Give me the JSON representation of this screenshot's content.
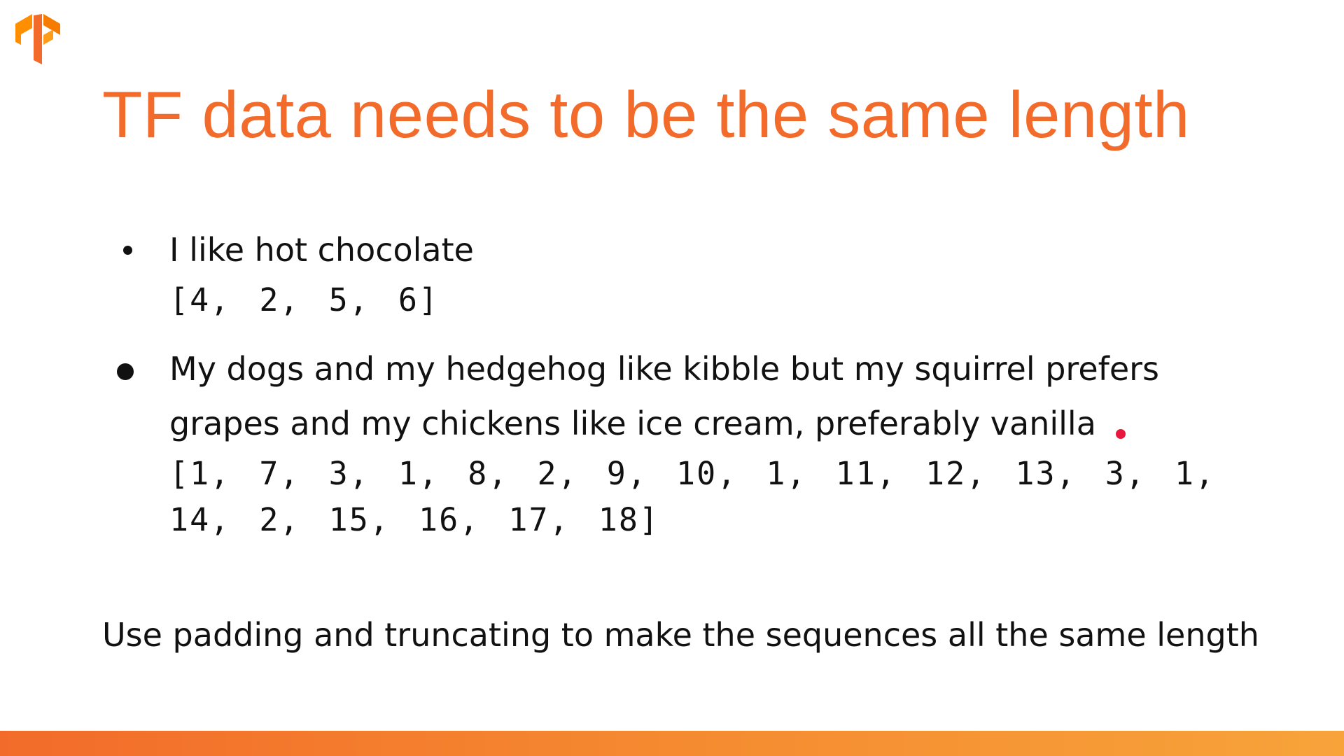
{
  "logo": {
    "icon": "tensorflow-logo-icon",
    "color": "#f26b2a"
  },
  "title": "TF data needs to be the same length",
  "bullets": [
    {
      "text": "I like hot chocolate",
      "sequence": "[4, 2, 5, 6]"
    },
    {
      "text": "My dogs and my hedgehog like kibble but my squirrel prefers grapes and my chickens like ice cream, preferably vanilla",
      "sequence": "[1, 7, 3, 1, 8, 2, 9, 10, 1, 11, 12, 13, 3, 1, 14, 2, 15, 16, 17, 18]"
    }
  ],
  "footer": "Use padding and truncating to make the sequences all the same length",
  "colors": {
    "accent": "#f26b2a",
    "pointer": "#e8173d"
  }
}
